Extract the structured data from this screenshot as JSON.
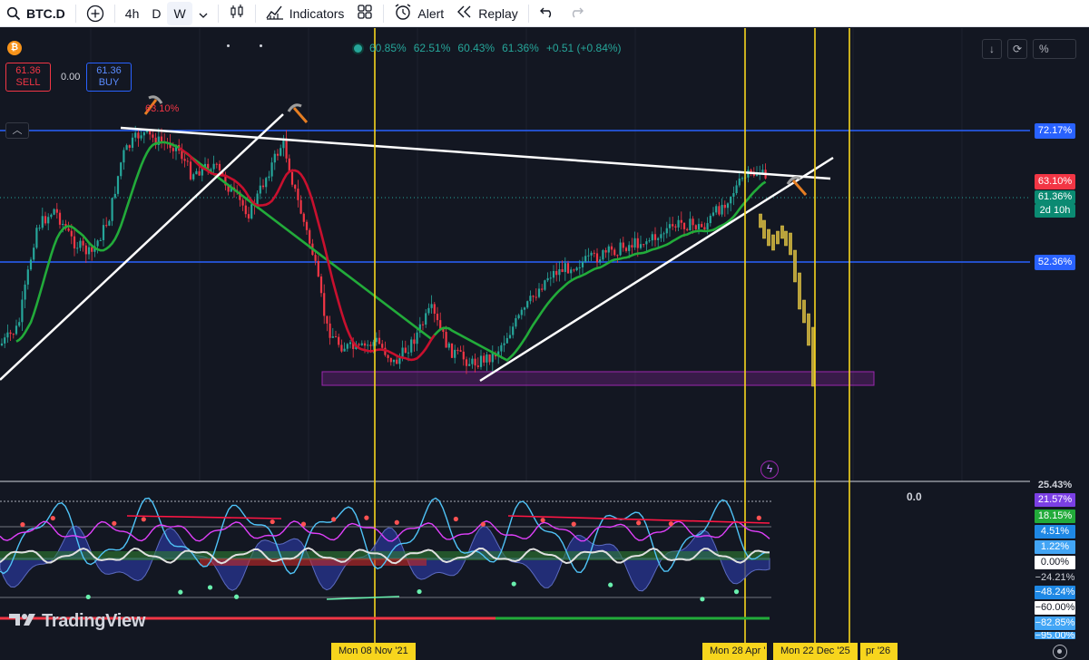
{
  "toolbar": {
    "symbol": "BTC.D",
    "intervals": [
      "4h",
      "D",
      "W"
    ],
    "active_interval": "W",
    "indicators_label": "Indicators",
    "alert_label": "Alert",
    "replay_label": "Replay"
  },
  "legend": {
    "open": "60.85%",
    "high": "62.51%",
    "low": "60.43%",
    "close": "61.36%",
    "change": "+0.51 (+0.84%)"
  },
  "trade": {
    "sell_price": "61.36",
    "sell_label": "SELL",
    "spread": "0.00",
    "buy_price": "61.36",
    "buy_label": "BUY"
  },
  "annotation_label": "63.10%",
  "right_buttons": {
    "percent_label": "%"
  },
  "price_scale": {
    "upper_line": "72.17%",
    "peak": "63.10%",
    "current": "61.36%",
    "countdown": "2d 10h",
    "lower_line": "52.36%"
  },
  "indicator_scale": [
    "25.43%",
    "21.57%",
    "18.15%",
    "4.51%",
    "1.22%",
    "0.00%",
    "−24.21%",
    "−48.24%",
    "−60.00%",
    "−82.85%",
    "−95.00%"
  ],
  "indicator_zero": "0.0",
  "date_labels": {
    "first": "Mon 08 Nov '21",
    "second": "Mon 28 Apr '",
    "third": "Mon 22 Dec '25",
    "fourth": "pr '26"
  },
  "brand": "TradingView",
  "colors": {
    "background": "#131722",
    "bull": "#26a69a",
    "bear": "#f23645",
    "blue_line": "#2962ff",
    "vertical_marker": "#f7d51d",
    "support_zone": "#9c27b0"
  }
}
